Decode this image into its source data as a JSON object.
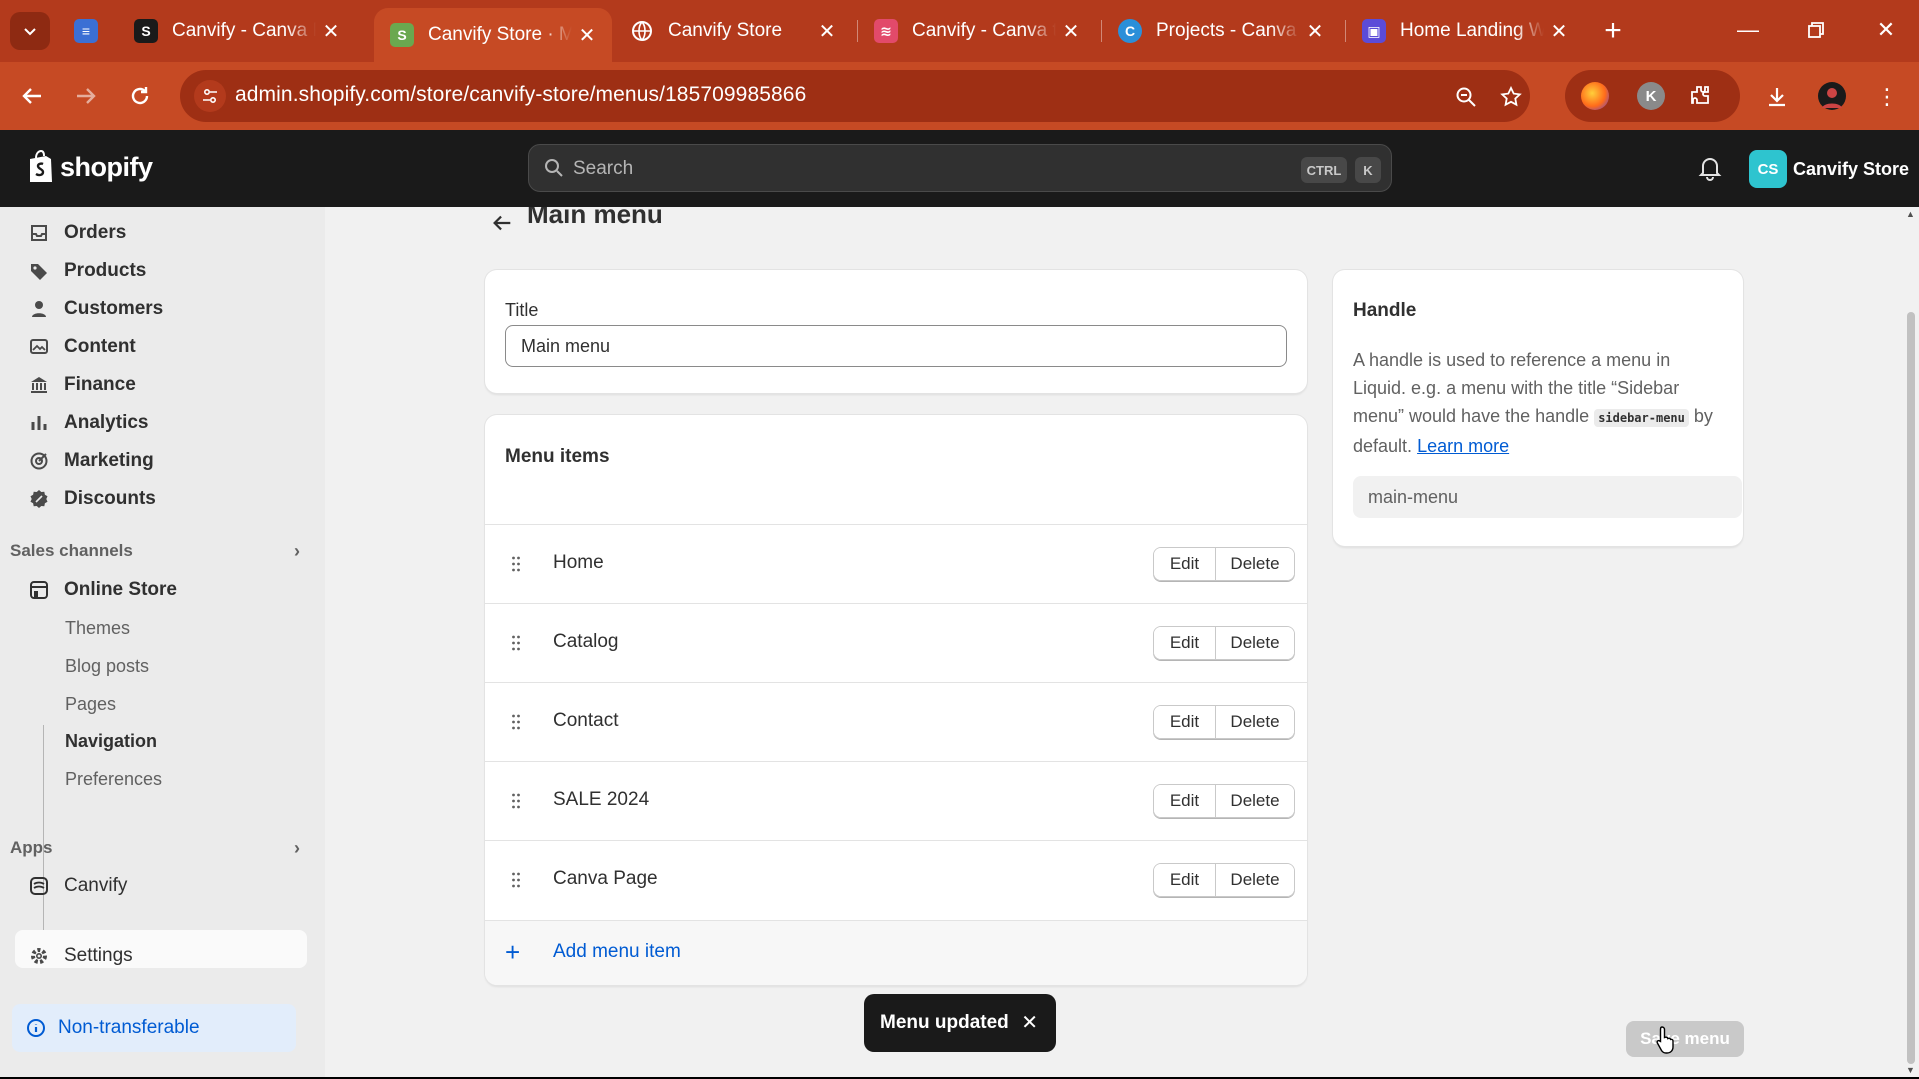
{
  "browser": {
    "tabs": [
      {
        "title": "Canvify - Canva P",
        "favicon": "shopify-icon",
        "active": false
      },
      {
        "title": "Canvify Store · M",
        "favicon": "shopify-icon",
        "active": true
      },
      {
        "title": "Canvify Store",
        "favicon": "globe-icon",
        "active": false
      },
      {
        "title": "Canvify - Canva t",
        "favicon": "canvify-icon",
        "active": false
      },
      {
        "title": "Projects - Canva",
        "favicon": "canva-icon",
        "active": false
      },
      {
        "title": "Home Landing W",
        "favicon": "landing-icon",
        "active": false
      }
    ],
    "url": "admin.shopify.com/store/canvify-store/menus/185709985866",
    "profile_letter": "K",
    "chrome_color": "#c64a24"
  },
  "shopify": {
    "logo_text": "shopify",
    "search_placeholder": "Search",
    "shortcut_keys": [
      "CTRL",
      "K"
    ],
    "store_initials": "CS",
    "store_name": "Canvify Store"
  },
  "sidebar": {
    "items": [
      {
        "label": "Orders",
        "icon": "orders-icon"
      },
      {
        "label": "Products",
        "icon": "tag-icon"
      },
      {
        "label": "Customers",
        "icon": "person-icon"
      },
      {
        "label": "Content",
        "icon": "content-icon"
      },
      {
        "label": "Finance",
        "icon": "bank-icon"
      },
      {
        "label": "Analytics",
        "icon": "bar-chart-icon"
      },
      {
        "label": "Marketing",
        "icon": "target-icon"
      },
      {
        "label": "Discounts",
        "icon": "discount-icon"
      }
    ],
    "sales_channels_label": "Sales channels",
    "online_store_label": "Online Store",
    "online_store_sub": [
      "Themes",
      "Blog posts",
      "Pages",
      "Navigation",
      "Preferences"
    ],
    "active_sub": "Navigation",
    "apps_label": "Apps",
    "apps": [
      "Canvify"
    ],
    "settings_label": "Settings",
    "non_transferable_label": "Non-transferable"
  },
  "page": {
    "title": "Main menu",
    "title_field_label": "Title",
    "title_field_value": "Main menu",
    "menu_items_heading": "Menu items",
    "menu_items": [
      "Home",
      "Catalog",
      "Contact",
      "SALE 2024",
      "Canva Page"
    ],
    "edit_label": "Edit",
    "delete_label": "Delete",
    "add_menu_item_label": "Add menu item",
    "handle": {
      "heading": "Handle",
      "desc_1": "A handle is used to reference a menu in Liquid. e.g. a menu with the title “Sidebar menu” would have the handle",
      "code": "sidebar-menu",
      "desc_2": "by default.",
      "link": "Learn more",
      "value": "main-menu"
    },
    "toast": "Menu updated",
    "save_label": "Save menu"
  }
}
